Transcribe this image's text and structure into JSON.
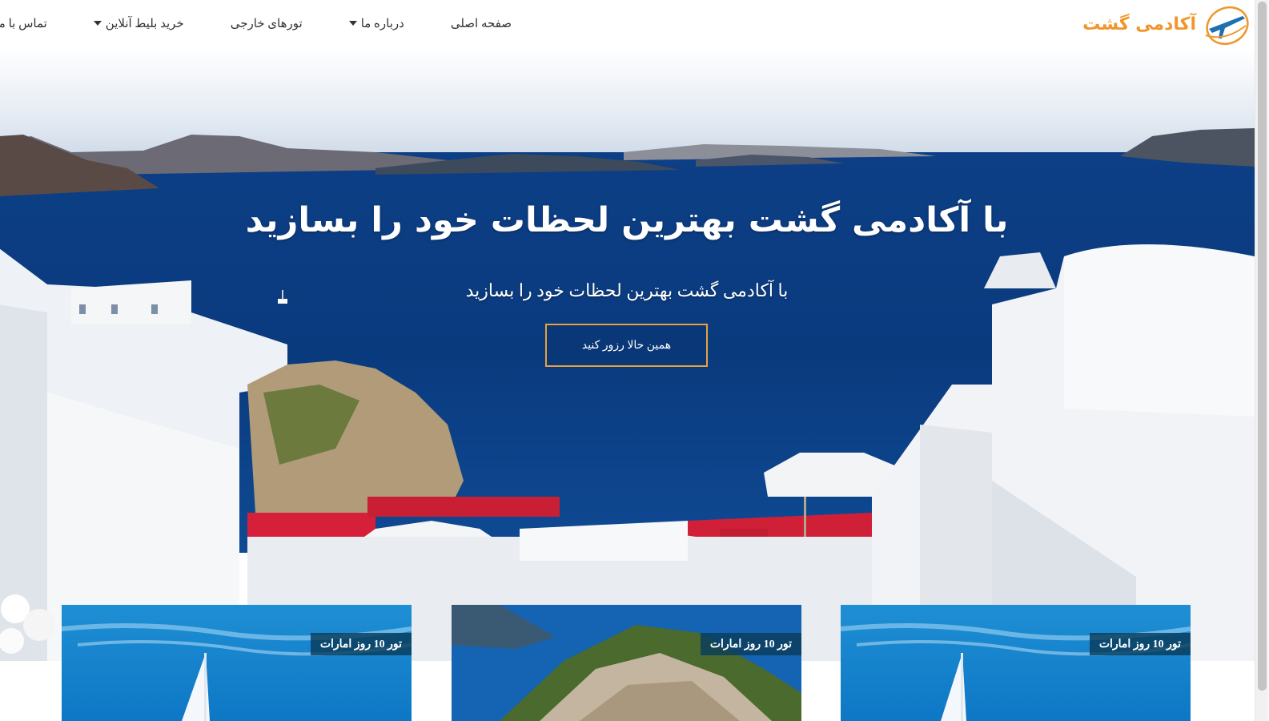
{
  "brand": {
    "name": "آکادمی گشت",
    "accent_color": "#f0962b",
    "logo_icon": "plane-orbit-icon"
  },
  "nav": {
    "items": [
      {
        "label": "صفحه اصلی",
        "has_dropdown": false
      },
      {
        "label": "درباره ما",
        "has_dropdown": true
      },
      {
        "label": "تورهای خارجی",
        "has_dropdown": false
      },
      {
        "label": "خرید بلیط آنلاین",
        "has_dropdown": true
      },
      {
        "label": "تماس با ما",
        "has_dropdown": false
      }
    ]
  },
  "hero": {
    "title": "با آکادمی گشت بهترین لحظات خود را بسازید",
    "subtitle": "با آکادمی گشت بهترین لحظات خود را بسازید",
    "cta_label": "همین حالا رزور کنید",
    "cta_border_color": "#e8a13c"
  },
  "cards": [
    {
      "tag": "تور 10 روز امارات",
      "image": "burj-al-arab-icon"
    },
    {
      "tag": "تور 10 روز امارات",
      "image": "island-cliff-icon"
    },
    {
      "tag": "تور 10 روز امارات",
      "image": "burj-al-arab-icon"
    }
  ]
}
